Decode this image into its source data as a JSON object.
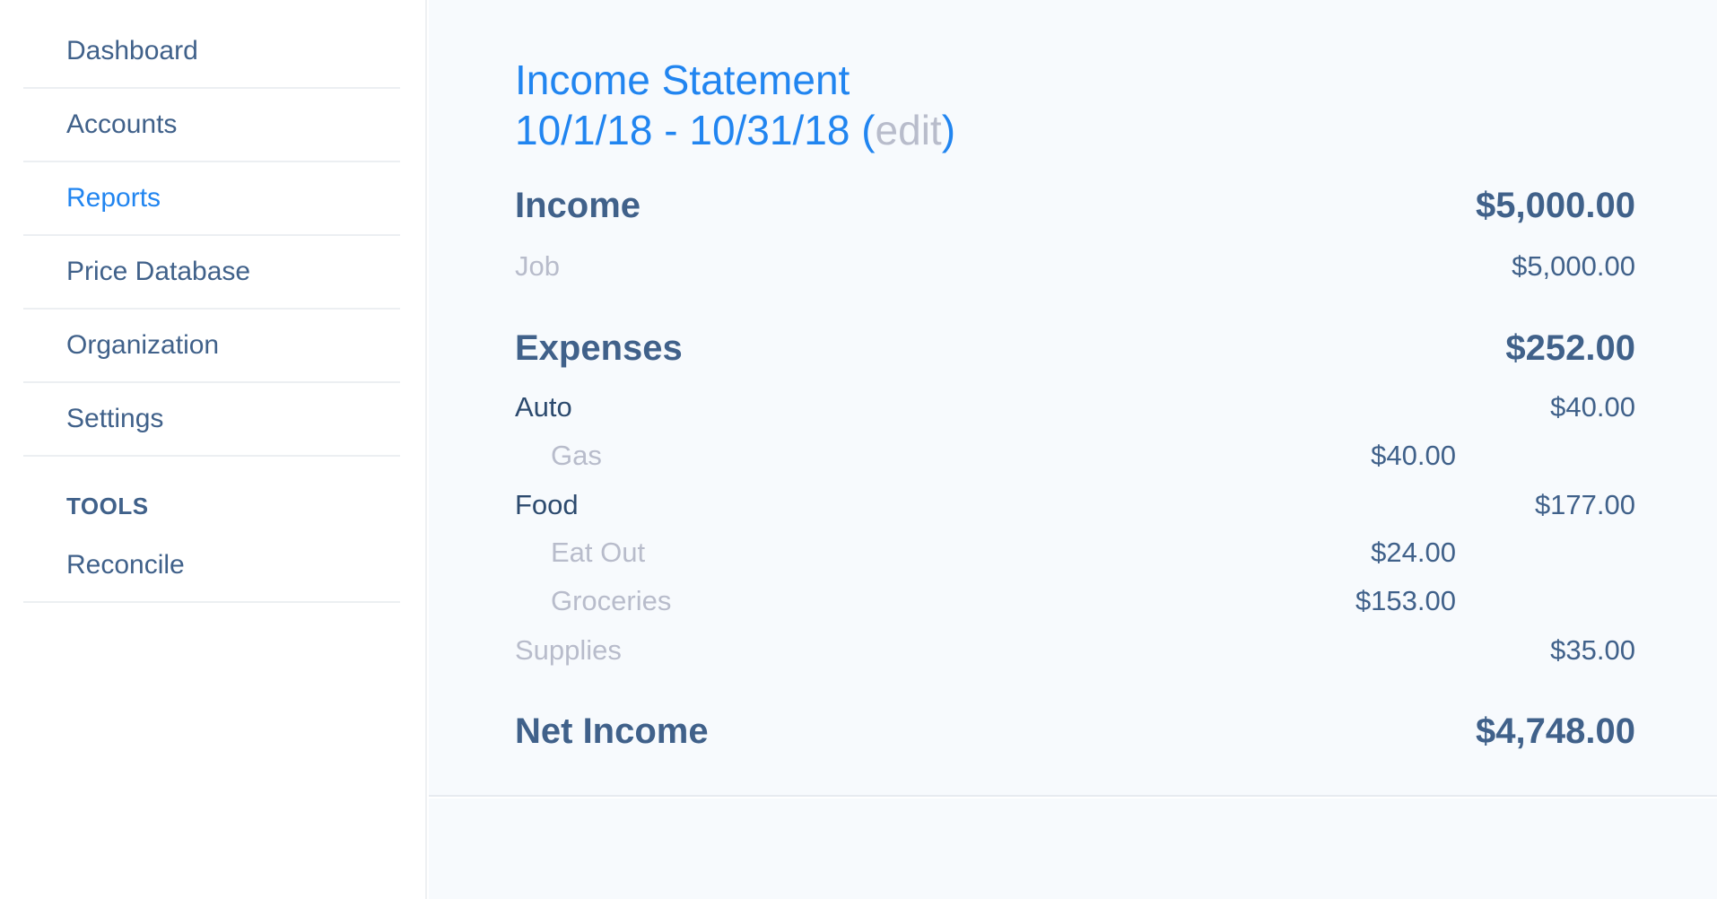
{
  "sidebar": {
    "items": [
      {
        "label": "Dashboard",
        "active": false
      },
      {
        "label": "Accounts",
        "active": false
      },
      {
        "label": "Reports",
        "active": true
      },
      {
        "label": "Price Database",
        "active": false
      },
      {
        "label": "Organization",
        "active": false
      },
      {
        "label": "Settings",
        "active": false
      }
    ],
    "tools_heading": "TOOLS",
    "tools_items": [
      {
        "label": "Reconcile"
      }
    ]
  },
  "colors": {
    "accent": "#2185f0",
    "text": "#40618a",
    "muted": "#b8bccb",
    "main_bg": "#f7fafd"
  },
  "report": {
    "title": "Income Statement",
    "date_range": "10/1/18 - 10/31/18",
    "open_paren": "(",
    "edit_label": "edit",
    "close_paren": ")",
    "income": {
      "label": "Income",
      "total": "$5,000.00",
      "rows": [
        {
          "label": "Job",
          "amount": "$5,000.00"
        }
      ]
    },
    "expenses": {
      "label": "Expenses",
      "total": "$252.00",
      "rows": [
        {
          "label": "Auto",
          "amount": "$40.00",
          "level": 0
        },
        {
          "label": "Gas",
          "amount": "$40.00",
          "level": 1
        },
        {
          "label": "Food",
          "amount": "$177.00",
          "level": 0
        },
        {
          "label": "Eat Out",
          "amount": "$24.00",
          "level": 1
        },
        {
          "label": "Groceries",
          "amount": "$153.00",
          "level": 1
        },
        {
          "label": "Supplies",
          "amount": "$35.00",
          "level": 0
        }
      ]
    },
    "net_income": {
      "label": "Net Income",
      "total": "$4,748.00"
    }
  }
}
